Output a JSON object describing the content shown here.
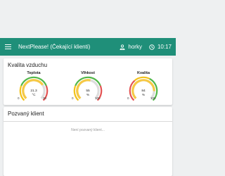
{
  "appbar": {
    "title": "NextPlease! (Čekající klienti)",
    "user": "horky",
    "time": "10:17",
    "color": "#1f8f79"
  },
  "air_quality": {
    "title": "Kvalita vzduchu",
    "gauges": [
      {
        "label": "Teplota",
        "value": "21.3",
        "unit": "°C",
        "min": "0",
        "max": "30",
        "fraction": 0.71
      },
      {
        "label": "Vlhkost",
        "value": "55",
        "unit": "%",
        "min": "0",
        "max": "100",
        "fraction": 0.55
      },
      {
        "label": "Kvalita",
        "value": "84",
        "unit": "%",
        "min": "0",
        "max": "100",
        "fraction": 0.84
      }
    ]
  },
  "invited": {
    "title": "Pozvaný klient",
    "empty_text": "Není pozvaný klient..."
  }
}
